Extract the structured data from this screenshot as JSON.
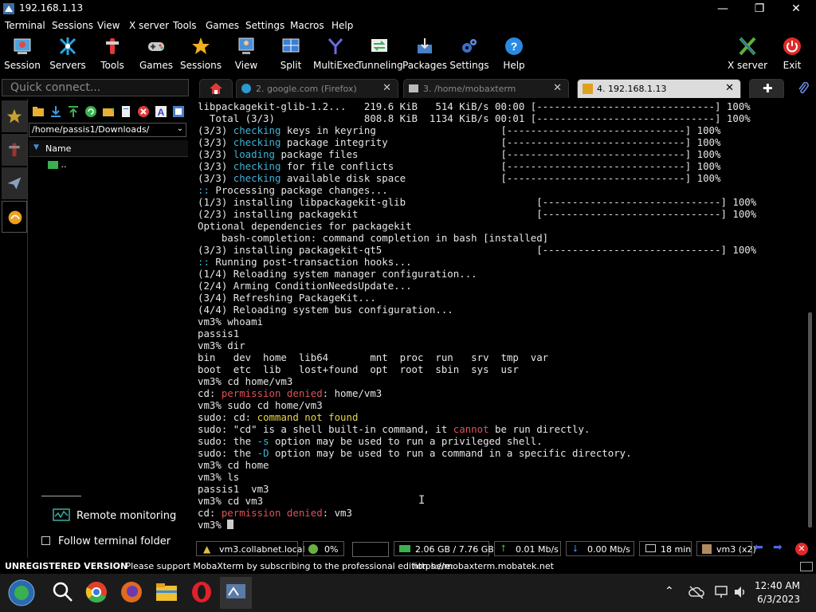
{
  "window": {
    "title": "192.168.1.13",
    "min": "—",
    "max": "❐",
    "close": "✕"
  },
  "menu": [
    "Terminal",
    "Sessions",
    "View",
    "X server",
    "Tools",
    "Games",
    "Settings",
    "Macros",
    "Help"
  ],
  "toolbar": {
    "items": [
      {
        "label": "Session",
        "icon": "session-icon",
        "color": "#4aa3e0"
      },
      {
        "label": "Servers",
        "icon": "servers-icon",
        "color": "#27a6e0"
      },
      {
        "label": "Tools",
        "icon": "tools-icon",
        "color": "#e03a3a"
      },
      {
        "label": "Games",
        "icon": "games-icon",
        "color": "#bbbbbb"
      },
      {
        "label": "Sessions",
        "icon": "star-icon",
        "color": "#f0b020"
      },
      {
        "label": "View",
        "icon": "view-icon",
        "color": "#4a90d9"
      },
      {
        "label": "Split",
        "icon": "split-icon",
        "color": "#3a7fd5"
      },
      {
        "label": "MultiExec",
        "icon": "multiexec-icon",
        "color": "#6a6ae0"
      },
      {
        "label": "Tunneling",
        "icon": "tunneling-icon",
        "color": "#3ab050"
      },
      {
        "label": "Packages",
        "icon": "packages-icon",
        "color": "#4a80c8"
      },
      {
        "label": "Settings",
        "icon": "gear-icon",
        "color": "#3a70c8"
      },
      {
        "label": "Help",
        "icon": "help-icon",
        "color": "#2a8ae0"
      }
    ],
    "xserver": "X server",
    "exit": "Exit"
  },
  "quick_connect": {
    "placeholder": "Quick connect..."
  },
  "sidebar": {
    "path": "/home/passis1/Downloads/",
    "column": "Name",
    "item": "..",
    "remote_monitoring": "Remote monitoring",
    "follow_folder": "Follow terminal folder"
  },
  "tabs": [
    {
      "label": "2. google.com (Firefox)",
      "active": false
    },
    {
      "label": "3. /home/mobaxterm",
      "active": false
    },
    {
      "label": "4. 192.168.1.13",
      "active": true
    }
  ],
  "terminal": {
    "lines": [
      [
        [
          "",
          "libpackagekit-glib-1.2...   219.6 KiB   514 KiB/s 00:00 [------------------------------] 100%"
        ]
      ],
      [
        [
          "",
          "  Total (3/3)               808.8 KiB  1134 KiB/s 00:01 [------------------------------] 100%"
        ]
      ],
      [
        [
          "",
          "(3/3) "
        ],
        [
          "c",
          "checking"
        ],
        [
          "",
          " keys in keyring                     [------------------------------] 100%"
        ]
      ],
      [
        [
          "",
          "(3/3) "
        ],
        [
          "c",
          "checking"
        ],
        [
          "",
          " package integrity                   [------------------------------] 100%"
        ]
      ],
      [
        [
          "",
          "(3/3) "
        ],
        [
          "c",
          "loading"
        ],
        [
          "",
          " package files                        [------------------------------] 100%"
        ]
      ],
      [
        [
          "",
          "(3/3) "
        ],
        [
          "c",
          "checking"
        ],
        [
          "",
          " for file conflicts                  [------------------------------] 100%"
        ]
      ],
      [
        [
          "",
          "(3/3) "
        ],
        [
          "c",
          "checking"
        ],
        [
          "",
          " available disk space                [------------------------------] 100%"
        ]
      ],
      [
        [
          "c",
          "::"
        ],
        [
          "",
          " Processing package changes..."
        ]
      ],
      [
        [
          "",
          "(1/3) installing libpackagekit-glib                      [------------------------------] 100%"
        ]
      ],
      [
        [
          "",
          "(2/3) installing packagekit                              [------------------------------] 100%"
        ]
      ],
      [
        [
          "",
          "Optional dependencies for packagekit"
        ]
      ],
      [
        [
          "",
          "    bash-completion: command completion in bash [installed]"
        ]
      ],
      [
        [
          "",
          "(3/3) installing packagekit-qt5                          [------------------------------] 100%"
        ]
      ],
      [
        [
          "c",
          "::"
        ],
        [
          "",
          " Running post-transaction hooks..."
        ]
      ],
      [
        [
          "",
          "(1/4) Reloading system manager configuration..."
        ]
      ],
      [
        [
          "",
          "(2/4) Arming ConditionNeedsUpdate..."
        ]
      ],
      [
        [
          "",
          "(3/4) Refreshing PackageKit..."
        ]
      ],
      [
        [
          "",
          "(4/4) Reloading system bus configuration..."
        ]
      ],
      [
        [
          "",
          "vm3% whoami"
        ]
      ],
      [
        [
          "",
          "passis1"
        ]
      ],
      [
        [
          "",
          "vm3% dir"
        ]
      ],
      [
        [
          "",
          "bin   dev  home  lib64       mnt  proc  run   srv  tmp  var"
        ]
      ],
      [
        [
          "",
          "boot  etc  lib   lost+found  opt  root  sbin  sys  usr"
        ]
      ],
      [
        [
          "",
          "vm3% cd home/vm3"
        ]
      ],
      [
        [
          "",
          "cd: "
        ],
        [
          "r",
          "permission denied"
        ],
        [
          "",
          ": home/vm3"
        ]
      ],
      [
        [
          "",
          "vm3% sudo cd home/vm3"
        ]
      ],
      [
        [
          "",
          "sudo: cd: "
        ],
        [
          "y",
          "command not found"
        ]
      ],
      [
        [
          "",
          "sudo: \"cd\" is a shell built-in command, it "
        ],
        [
          "r",
          "cannot"
        ],
        [
          "",
          " be run directly."
        ]
      ],
      [
        [
          "",
          "sudo: the "
        ],
        [
          "c",
          "-s"
        ],
        [
          "",
          " option may be used to run a privileged shell."
        ]
      ],
      [
        [
          "",
          "sudo: the "
        ],
        [
          "c",
          "-D"
        ],
        [
          "",
          " option may be used to run a command in a specific directory."
        ]
      ],
      [
        [
          "",
          "vm3% cd home"
        ]
      ],
      [
        [
          "",
          "vm3% ls"
        ]
      ],
      [
        [
          "",
          "passis1  vm3"
        ]
      ],
      [
        [
          "",
          "vm3% cd vm3"
        ]
      ],
      [
        [
          "",
          "cd: "
        ],
        [
          "r",
          "permission denied"
        ],
        [
          "",
          ": vm3"
        ]
      ],
      [
        [
          "",
          "vm3% "
        ]
      ]
    ]
  },
  "status": {
    "host": "vm3.collabnet.local",
    "cpu": "0%",
    "mem": "2.06 GB / 7.76 GB",
    "up": "0.01 Mb/s",
    "down": "0.00 Mb/s",
    "uptime": "18 min",
    "user": "vm3 (x2)"
  },
  "unregistered": {
    "bold": "UNREGISTERED VERSION",
    "text": " -  Please support MobaXterm by subscribing to the professional edition here:  ",
    "link": "https://mobaxterm.mobatek.net"
  },
  "taskbar": {
    "time": "12:40 AM",
    "date": "6/3/2023"
  }
}
